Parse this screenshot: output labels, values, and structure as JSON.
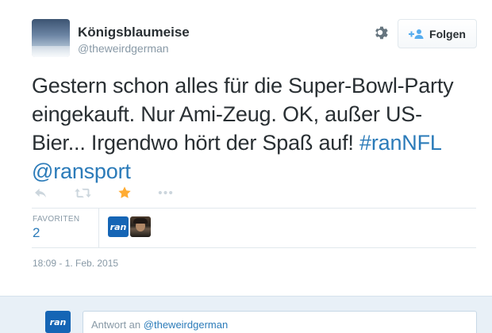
{
  "user": {
    "display_name": "Königsblaumeise",
    "handle": "@theweirdgerman"
  },
  "follow_button": {
    "label": "Folgen"
  },
  "tweet": {
    "text": "Gestern schon alles für die Super-Bowl-Party eingekauft. Nur Ami-Zeug. OK, außer US-Bier... Irgendwo hört der Spaß auf!",
    "hashtag": "#ranNFL",
    "mention": "@ransport"
  },
  "stats": {
    "favorites_label": "FAVORITEN",
    "favorites_count": "2",
    "fav_user_ran_label": "ran"
  },
  "timestamp": "18:09 - 1. Feb. 2015",
  "reply": {
    "avatar_label": "ran",
    "prefix": "Antwort an",
    "mention": "@theweirdgerman"
  },
  "colors": {
    "link": "#2b7bb9",
    "muted": "#8899a6",
    "favorite_star": "#ffac33"
  },
  "icons": [
    "gear-icon",
    "add-user-icon",
    "reply-icon",
    "retweet-icon",
    "star-icon",
    "more-icon"
  ]
}
